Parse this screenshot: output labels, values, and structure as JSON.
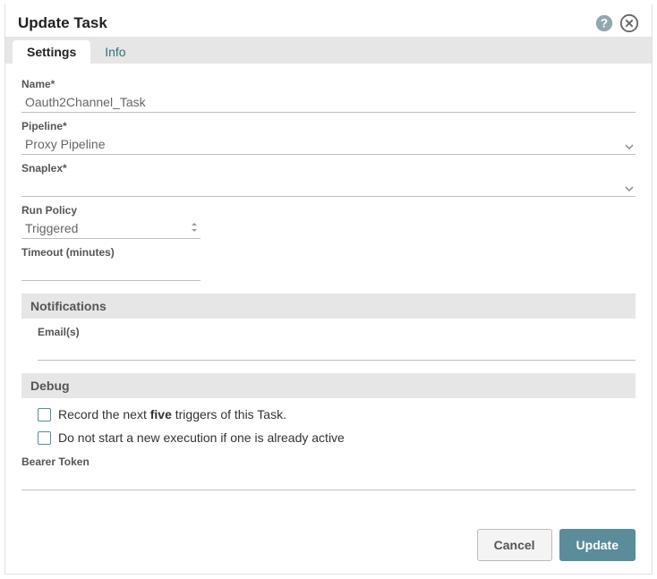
{
  "dialog": {
    "title": "Update Task"
  },
  "tabs": {
    "settings": "Settings",
    "info": "Info"
  },
  "fields": {
    "name_label": "Name*",
    "name_value": "Oauth2Channel_Task",
    "pipeline_label": "Pipeline*",
    "pipeline_value": "Proxy Pipeline",
    "snaplex_label": "Snaplex*",
    "snaplex_value": "",
    "runpolicy_label": "Run Policy",
    "runpolicy_value": "Triggered",
    "timeout_label": "Timeout (minutes)",
    "timeout_value": "",
    "bearer_label": "Bearer Token",
    "bearer_value": ""
  },
  "sections": {
    "notifications": "Notifications",
    "emails_label": "Email(s)",
    "emails_value": "",
    "debug": "Debug",
    "debug_check1_pre": "Record the next ",
    "debug_check1_bold": "five",
    "debug_check1_post": " triggers of this Task.",
    "debug_check2": "Do not start a new execution if one is already active"
  },
  "buttons": {
    "cancel": "Cancel",
    "update": "Update"
  }
}
